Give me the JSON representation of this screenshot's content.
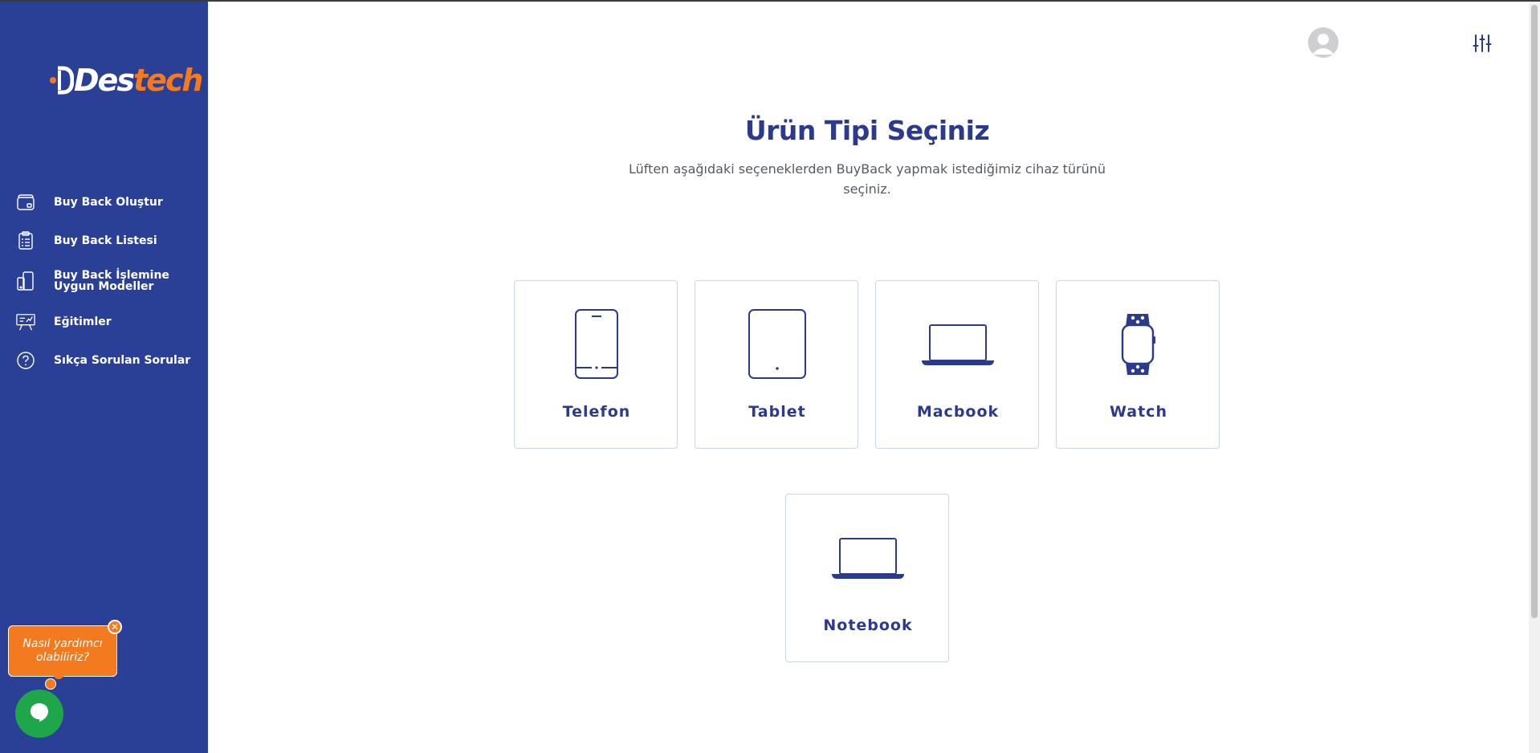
{
  "logo": {
    "part1": "Des",
    "part2": "tech"
  },
  "sidebar": {
    "items": [
      {
        "label": "Buy Back Oluştur",
        "icon": "wallet-icon"
      },
      {
        "label": "Buy Back Listesi",
        "icon": "clipboard-list-icon"
      },
      {
        "label": "Buy Back İşlemine Uygun Modeller",
        "icon": "devices-icon"
      },
      {
        "label": "Eğitimler",
        "icon": "presentation-icon"
      },
      {
        "label": "Sıkça Sorulan Sorular",
        "icon": "question-circle-icon"
      }
    ]
  },
  "chat": {
    "bubble_text": "Nasıl yardımcı olabiliriz?",
    "close_glyph": "✕"
  },
  "main": {
    "title": "Ürün Tipi Seçiniz",
    "subtitle": "Lüften aşağıdaki seçeneklerden BuyBack yapmak istediğimiz cihaz türünü seçiniz.",
    "cards": [
      {
        "label": "Telefon",
        "icon": "phone-icon"
      },
      {
        "label": "Tablet",
        "icon": "tablet-icon"
      },
      {
        "label": "Macbook",
        "icon": "laptop-icon"
      },
      {
        "label": "Watch",
        "icon": "watch-icon"
      },
      {
        "label": "Notebook",
        "icon": "laptop-icon"
      }
    ]
  },
  "colors": {
    "sidebar": "#2a3f96",
    "accent": "#f47a20",
    "primary_text": "#2b3a8c",
    "chat_green": "#1fa54a",
    "card_border": "#c6d7ee"
  }
}
